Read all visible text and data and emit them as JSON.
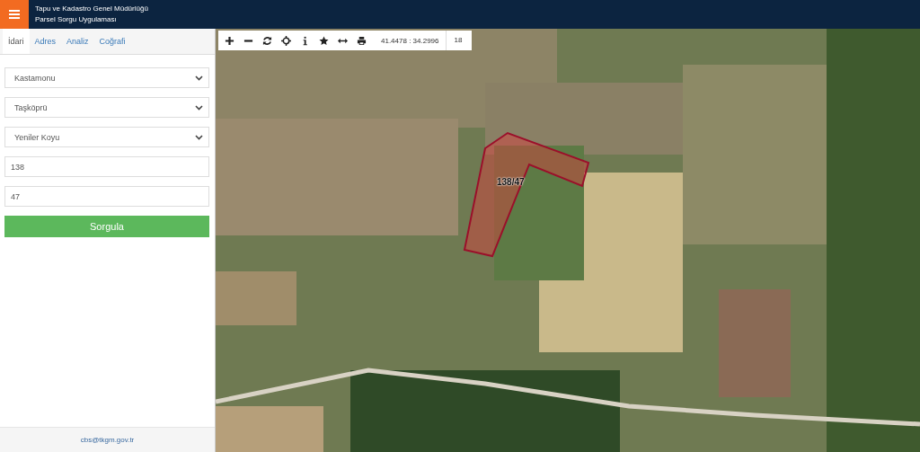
{
  "header": {
    "title": "Tapu ve Kadastro Genel Müdürlüğü",
    "subtitle": "Parsel Sorgu Uygulaması"
  },
  "tabs": [
    {
      "label": "İdari",
      "selected": true
    },
    {
      "label": "Adres",
      "selected": false
    },
    {
      "label": "Analiz",
      "selected": false
    },
    {
      "label": "Coğrafi",
      "selected": false
    }
  ],
  "form": {
    "fields": [
      {
        "kind": "select",
        "value": "Kastamonu"
      },
      {
        "kind": "select",
        "value": "Taşköprü"
      },
      {
        "kind": "select",
        "value": "Yeniler Koyu"
      },
      {
        "kind": "input",
        "value": "138"
      },
      {
        "kind": "input",
        "value": "47"
      }
    ],
    "button": "Sorgula"
  },
  "footer": {
    "email": "cbs@tkgm.gov.tr"
  },
  "map": {
    "toolbar": {
      "coordinates": "41.4478 : 34.2996",
      "zoom": "18"
    },
    "parcel_label": "138/47"
  }
}
